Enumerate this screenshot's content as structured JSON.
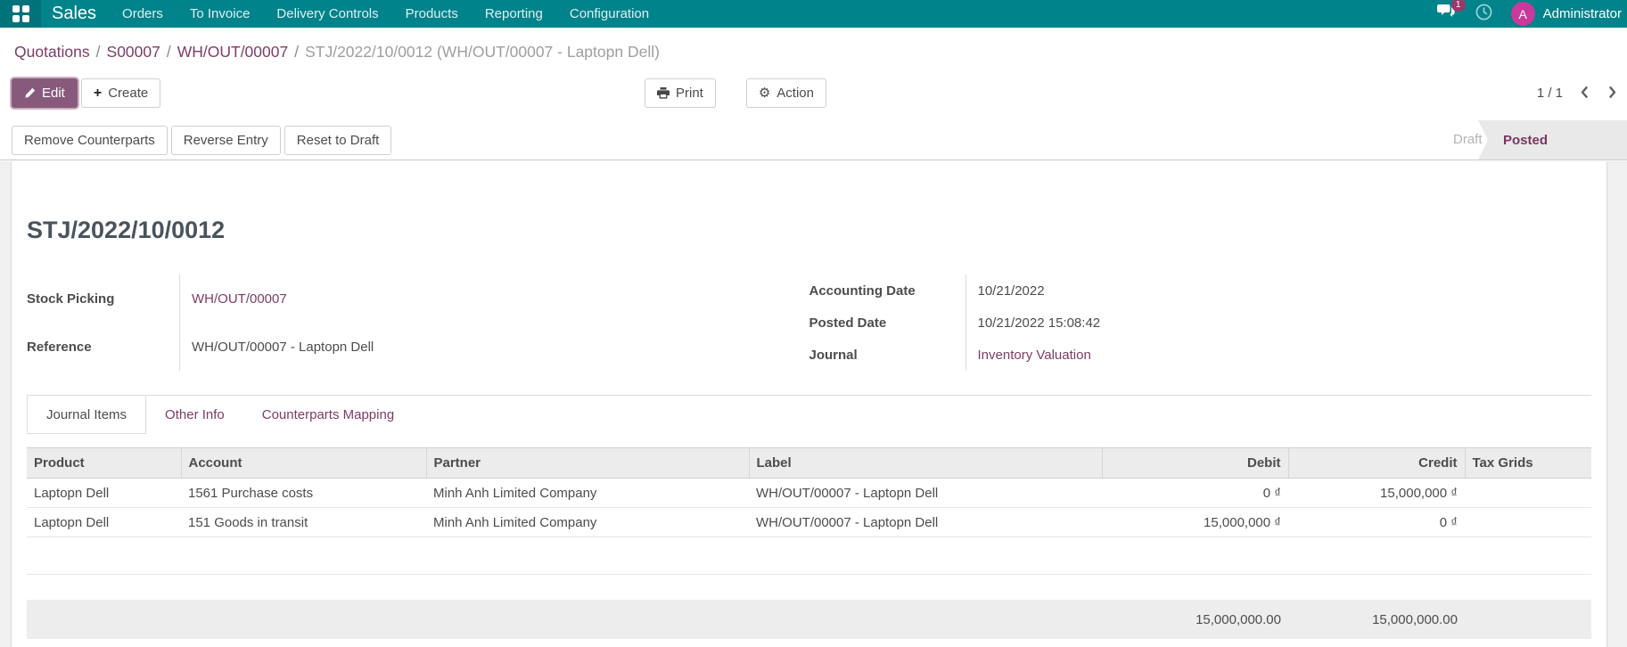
{
  "navbar": {
    "app_name": "Sales",
    "menu_items": [
      "Orders",
      "To Invoice",
      "Delivery Controls",
      "Products",
      "Reporting",
      "Configuration"
    ],
    "message_badge": "1",
    "user_initial": "A",
    "user_name": "Administrator"
  },
  "breadcrumb": {
    "items": [
      "Quotations",
      "S00007",
      "WH/OUT/00007"
    ],
    "current": "STJ/2022/10/0012 (WH/OUT/00007 - Laptopn Dell)",
    "separator": "/"
  },
  "control_panel": {
    "edit_label": "Edit",
    "create_label": "Create",
    "print_label": "Print",
    "action_label": "Action",
    "pager": "1 / 1"
  },
  "action_buttons": {
    "remove_counterparts": "Remove Counterparts",
    "reverse_entry": "Reverse Entry",
    "reset_to_draft": "Reset to Draft"
  },
  "statusbar": {
    "draft": "Draft",
    "posted": "Posted"
  },
  "form": {
    "title": "STJ/2022/10/0012",
    "fields_left": [
      {
        "label": "Stock Picking",
        "value": "WH/OUT/00007"
      },
      {
        "label": "Reference",
        "value": "WH/OUT/00007 - Laptopn Dell"
      }
    ],
    "fields_right": [
      {
        "label": "Accounting Date",
        "value": "10/21/2022"
      },
      {
        "label": "Posted Date",
        "value": "10/21/2022 15:08:42"
      },
      {
        "label": "Journal",
        "value": "Inventory Valuation"
      }
    ],
    "tabs": [
      {
        "label": "Journal Items"
      },
      {
        "label": "Other Info"
      },
      {
        "label": "Counterparts Mapping"
      }
    ]
  },
  "table": {
    "columns": [
      "Product",
      "Account",
      "Partner",
      "Label",
      "Debit",
      "Credit",
      "Tax Grids"
    ],
    "rows": [
      {
        "product": "Laptopn Dell",
        "account": "1561 Purchase costs",
        "partner": "Minh Anh Limited Company",
        "label": "WH/OUT/00007 - Laptopn Dell",
        "debit": "0 ₫",
        "credit": "15,000,000 ₫",
        "tax_grids": ""
      },
      {
        "product": "Laptopn Dell",
        "account": "151 Goods in transit",
        "partner": "Minh Anh Limited Company",
        "label": "WH/OUT/00007 - Laptopn Dell",
        "debit": "15,000,000 ₫",
        "credit": "0 ₫",
        "tax_grids": ""
      }
    ],
    "totals": {
      "debit": "15,000,000.00",
      "credit": "15,000,000.00"
    }
  },
  "icons": {
    "gear": "⚙",
    "plus": "+"
  },
  "colors": {
    "navbar_bg": "#00838b",
    "navbar_apps_bg": "#00737a",
    "primary_button": "#875a7b",
    "link": "#7d3c66",
    "posted_text": "#7a3660",
    "statusbar_bg": "#e9e9e9",
    "badge_bg": "#993968",
    "avatar_bg": "#c83a9b",
    "table_header_bg": "#ececec",
    "totals_bg": "#ededed"
  }
}
